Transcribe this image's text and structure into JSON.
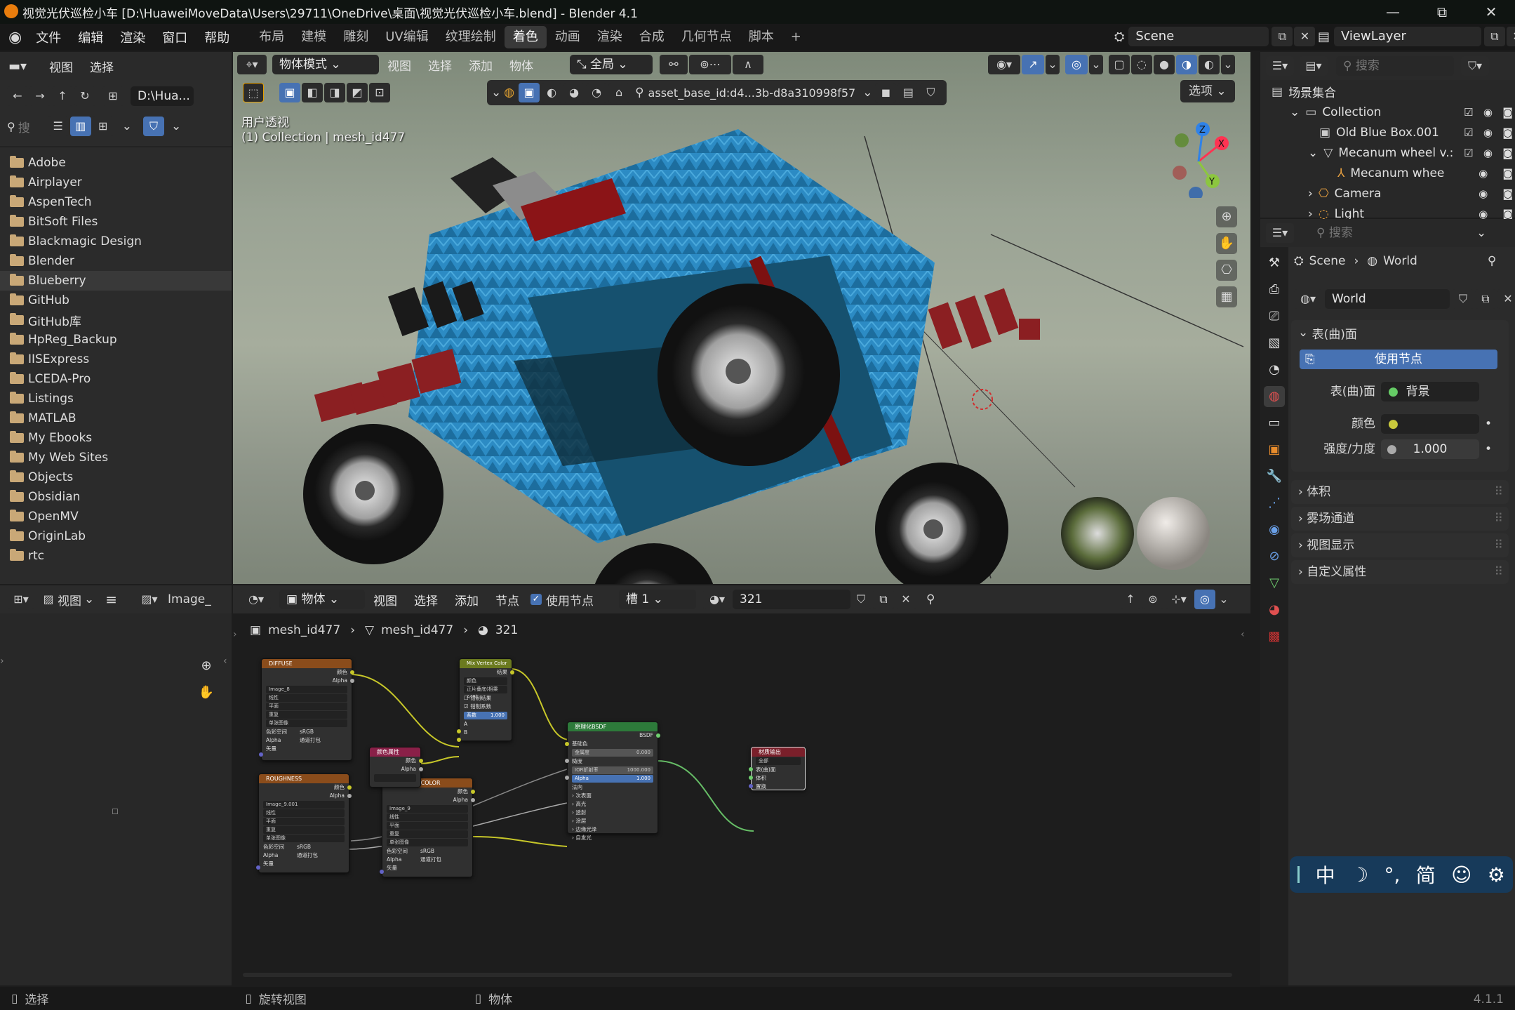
{
  "window": {
    "title": "视觉光伏巡检小车 [D:\\HuaweiMoveData\\Users\\29711\\OneDrive\\桌面\\视觉光伏巡检小车.blend] - Blender 4.1",
    "min": "—",
    "max": "⧉",
    "close": "✕"
  },
  "menu": [
    "文件",
    "编辑",
    "渲染",
    "窗口",
    "帮助"
  ],
  "workspaces": [
    "布局",
    "建模",
    "雕刻",
    "UV编辑",
    "纹理绘制",
    "着色",
    "动画",
    "渲染",
    "合成",
    "几何节点",
    "脚本",
    "+"
  ],
  "scene_field": "Scene",
  "viewlayer_field": "ViewLayer",
  "file_browser": {
    "menu": [
      "视图",
      "选择"
    ],
    "path": "D:\\Hua...",
    "search_placeholder": "搜",
    "folders": [
      "Adobe",
      "Airplayer",
      "AspenTech",
      "BitSoft Files",
      "Blackmagic Design",
      "Blender",
      "Blueberry",
      "GitHub",
      "GitHub库",
      "HpReg_Backup",
      "IISExpress",
      "LCEDA-Pro",
      "Listings",
      "MATLAB",
      "My Ebooks",
      "My Web Sites",
      "Objects",
      "Obsidian",
      "OpenMV",
      "OriginLab",
      "rtc"
    ],
    "selected": "Blueberry"
  },
  "viewport": {
    "mode": "物体模式",
    "menu": [
      "视图",
      "选择",
      "添加",
      "物体"
    ],
    "transform": "全局",
    "overlay_label": "用户透视",
    "overlay_sub": "(1) Collection | mesh_id477",
    "asset_field": "asset_base_id:d4...3b-d8a310998f57",
    "options": "选项",
    "axis": {
      "x": "X",
      "y": "Y",
      "z": "Z"
    }
  },
  "outliner": {
    "search_placeholder": "搜索",
    "items": [
      {
        "label": "场景集合",
        "indent": 0
      },
      {
        "label": "Collection",
        "indent": 1
      },
      {
        "label": "Old Blue Box.001",
        "indent": 2
      },
      {
        "label": "Mecanum wheel v.:",
        "indent": 2
      },
      {
        "label": "Mecanum whee",
        "indent": 3
      },
      {
        "label": "Camera",
        "indent": 2
      },
      {
        "label": "Light",
        "indent": 2
      }
    ]
  },
  "properties": {
    "search_placeholder": "搜索",
    "breadcrumb": [
      "Scene",
      "World"
    ],
    "world_name": "World",
    "surface_panel": "表(曲)面",
    "use_nodes": "使用节点",
    "surface_label": "表(曲)面",
    "surface_value": "背景",
    "color_label": "颜色",
    "strength_label": "强度/力度",
    "strength_value": "1.000",
    "collapsed_panels": [
      "体积",
      "雾场通道",
      "视图显示",
      "自定义属性"
    ]
  },
  "image_editor": {
    "view_label": "视图",
    "image_label": "Image_"
  },
  "node_editor": {
    "object_mode": "物体",
    "menu": [
      "视图",
      "选择",
      "添加",
      "节点"
    ],
    "use_nodes": "使用节点",
    "slot": "槽 1",
    "material": "321",
    "breadcrumb": [
      "mesh_id477",
      "mesh_id477",
      "321"
    ],
    "nodes": {
      "diffuse": {
        "title": "DIFFUSE",
        "image": "Image_8",
        "out1": "颜色",
        "out2": "Alpha",
        "rows": [
          "线性",
          "平面",
          "重复",
          "单张图像"
        ],
        "cs_label": "色彩空间",
        "cs_val": "sRGB",
        "alpha_label": "Alpha",
        "alpha_val": "通道打包",
        "vec": "矢量"
      },
      "roughness": {
        "title": "ROUGHNESS",
        "image": "Image_9.001",
        "out1": "颜色",
        "out2": "Alpha",
        "rows": [
          "线性",
          "平面",
          "重复",
          "单张图像"
        ],
        "cs_label": "色彩空间",
        "cs_val": "sRGB",
        "alpha_label": "Alpha",
        "alpha_val": "通道打包",
        "vec": "矢量"
      },
      "specular": {
        "title": "SPECULAR COLOR",
        "image": "Image_9",
        "out1": "颜色",
        "out2": "Alpha",
        "rows": [
          "线性",
          "平面",
          "重复",
          "单张图像"
        ],
        "cs_label": "色彩空间",
        "cs_val": "sRGB",
        "alpha_label": "Alpha",
        "alpha_val": "通道打包",
        "vec": "矢量"
      },
      "mix": {
        "title": "Mix Vertex Color",
        "out": "结果",
        "dd1": "颜色",
        "dd2": "正片叠底(相乘 A*B)",
        "chk1": "钳制结果",
        "chk2": "钳制系数",
        "fac": "系数",
        "fac_val": "1.000",
        "a": "A",
        "b": "B"
      },
      "attr": {
        "title": "颜色属性",
        "out1": "颜色",
        "out2": "Alpha"
      },
      "bsdf": {
        "title": "原理化BSDF",
        "out": "BSDF",
        "rows": [
          "基础色",
          "金属度",
          "糙度",
          "IOR折射率",
          "Alpha",
          "法向",
          "次表面",
          "高光",
          "透射",
          "涂层",
          "边缘光泽",
          "自发光"
        ],
        "metal_val": "0.000",
        "ior_val": "1000.000",
        "alpha_val": "1.000"
      },
      "output": {
        "title": "材质输出",
        "dd": "全部",
        "rows": [
          "表(曲)面",
          "体积",
          "置换"
        ]
      }
    }
  },
  "ime": [
    "中",
    "☽",
    "°,",
    "简",
    "☺",
    "⚙"
  ],
  "status": {
    "left": "选择",
    "mid": "旋转视图",
    "right": "物体",
    "version": "4.1.1"
  }
}
